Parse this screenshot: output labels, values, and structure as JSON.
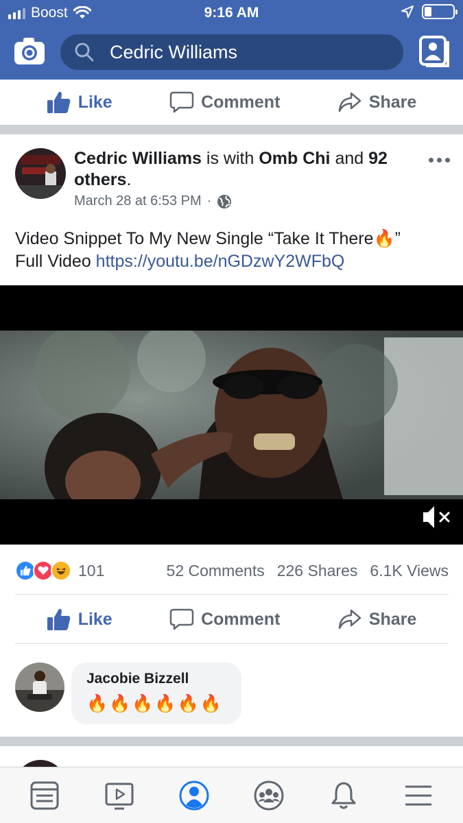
{
  "status_bar": {
    "carrier": "Boost",
    "time": "9:16 AM"
  },
  "header": {
    "search_value": "Cedric Williams",
    "icons": [
      "camera-icon",
      "search-icon",
      "profile-card-icon"
    ],
    "color": "#4267b2"
  },
  "top_actions": {
    "like": "Like",
    "comment": "Comment",
    "share": "Share"
  },
  "post": {
    "author": "Cedric Williams",
    "with_text": "is with",
    "tagged": "Omb Chi",
    "and_text": "and",
    "others": "92 others",
    "period": ".",
    "time": "March 28 at 6:53 PM",
    "dot": "·",
    "text_line1": "Video Snippet To My New Single “Take It There🔥”",
    "text_prefix": "Full Video",
    "link": "https://youtu.be/nGDzwY2WFbQ",
    "video": {
      "muted": true
    }
  },
  "stats": {
    "reaction_icons": [
      "like-reaction-icon",
      "love-reaction-icon",
      "haha-reaction-icon"
    ],
    "reaction_count": "101",
    "comments": "52 Comments",
    "shares": "226 Shares",
    "views": "6.1K Views"
  },
  "post_actions": {
    "like": "Like",
    "comment": "Comment",
    "share": "Share"
  },
  "comment": {
    "author": "Jacobie Bizzell",
    "text": "🔥🔥🔥🔥🔥🔥"
  },
  "tabbar": {
    "tabs": [
      "news-feed-icon",
      "watch-icon",
      "profile-icon",
      "groups-icon",
      "notifications-icon",
      "menu-icon"
    ],
    "active": "profile-icon",
    "active_color": "#1877f2"
  }
}
